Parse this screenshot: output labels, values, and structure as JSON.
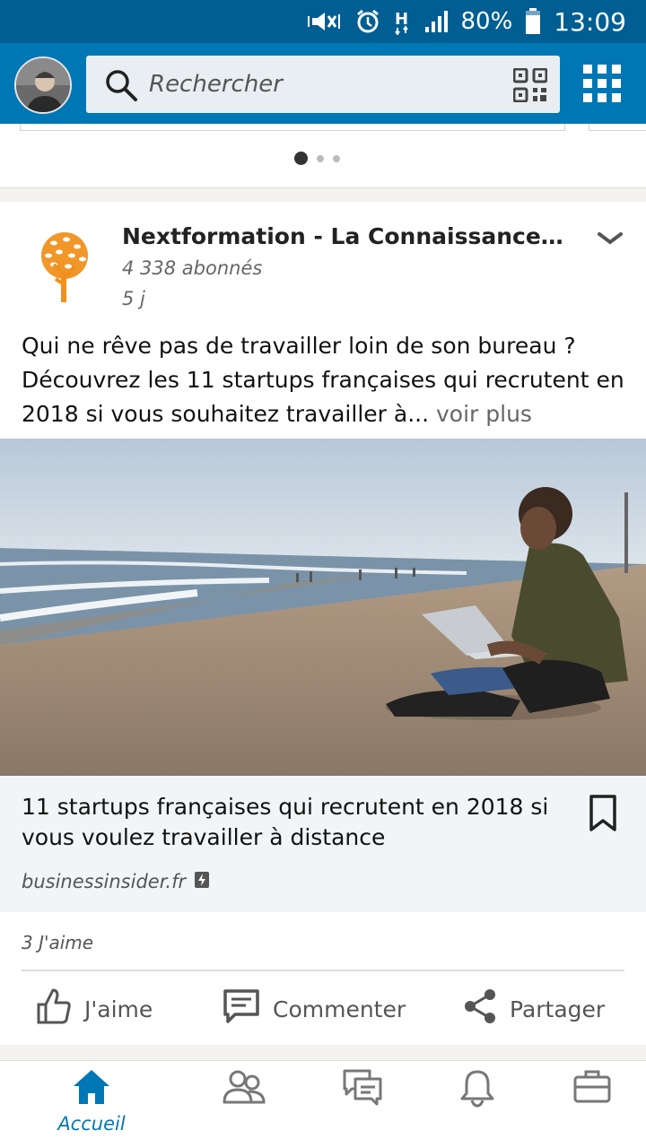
{
  "status_bar": {
    "battery": "80%",
    "time": "13:09"
  },
  "header": {
    "search_placeholder": "Rechercher"
  },
  "carousel": {
    "dots": 3,
    "active_index": 0
  },
  "post": {
    "company_name": "Nextformation - La Connaissance au...",
    "followers": "4 338 abonnés",
    "age": "5 j",
    "text": "Qui ne rêve pas de travailler loin de son bureau ? Découvrez les 11 startups françaises qui recrutent en 2018 si vous souhaitez travailler à...",
    "see_more": " voir plus",
    "link_title": "11 startups françaises qui recrutent en 2018 si vous voulez travailler à distance",
    "link_domain": "businessinsider.fr",
    "likes": "3 J'aime"
  },
  "actions": {
    "like": "J'aime",
    "comment": "Commenter",
    "share": "Partager"
  },
  "bottom_nav": {
    "home": "Accueil"
  },
  "colors": {
    "brand": "#0077b5",
    "status_bar": "#005e93",
    "logo_orange": "#f0901e"
  }
}
